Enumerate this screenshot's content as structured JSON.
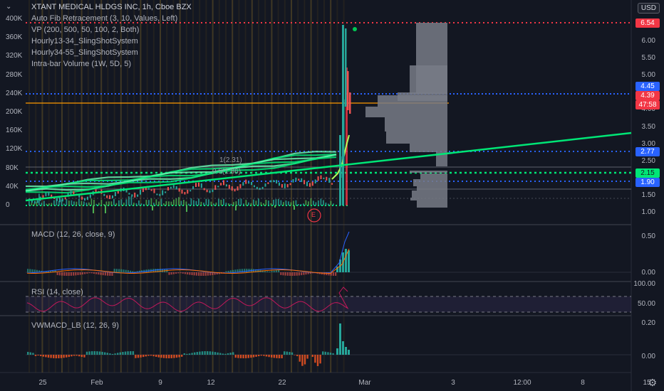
{
  "chart": {
    "title": "XTANT MEDICAL HLDGS INC, 1h, Cboe BZX",
    "indicators": [
      "Auto Fib Retracement (3, 10, Values, Left)",
      "VP (200, 500, 50, 100, 2, Both)",
      "Hourly13-34_SlingShotSystem",
      "Hourly34-55_SlingShotSystem",
      "Intra-bar Volume (1W, 5D, 5)"
    ],
    "currency": "USD",
    "fib_label_1": "1(2.31)",
    "fib_label_2": "0.5(1.86)",
    "earnings_marker": "E",
    "volume_axis": [
      "400K",
      "360K",
      "320K",
      "280K",
      "240K",
      "200K",
      "160K",
      "120K",
      "80K",
      "40K",
      "0"
    ],
    "price_axis": [
      "6.00",
      "5.50",
      "5.00",
      "4.50",
      "4.00",
      "3.50",
      "3.00",
      "2.50",
      "2.00",
      "1.50",
      "1.00"
    ],
    "price_badges": {
      "top": {
        "text": "6.54",
        "color": "#f23645"
      },
      "high": {
        "text": "4.45",
        "color": "#2962ff"
      },
      "last": {
        "text": "4.39",
        "color": "#f23645"
      },
      "countdown": {
        "text": "47:58",
        "color": "#f23645"
      },
      "mid": {
        "text": "2.77",
        "color": "#2962ff"
      },
      "green": {
        "text": "2.15",
        "color": "#00e676"
      },
      "low": {
        "text": "1.90",
        "color": "#2962ff"
      }
    },
    "x_axis": [
      "25",
      "Feb",
      "9",
      "12",
      "22",
      "Mar",
      "3",
      "12:00",
      "8",
      "15"
    ]
  },
  "macd": {
    "title": "MACD (12, 26, close, 9)",
    "axis": [
      "0.50",
      "0.00"
    ]
  },
  "rsi": {
    "title": "RSI (14, close)",
    "axis": [
      "100.00",
      "50.00"
    ]
  },
  "vwmacd": {
    "title": "VWMACD_LB (12, 26, 9)",
    "axis": [
      "0.20",
      "0.00"
    ]
  },
  "chart_data": {
    "type": "line",
    "title": "XTANT MEDICAL HLDGS INC, 1h, Cboe BZX",
    "x": [
      "25",
      "Feb",
      "9",
      "12",
      "22",
      "Mar"
    ],
    "series": [
      {
        "values": [
          1.45,
          1.55,
          1.62,
          1.72,
          1.82,
          1.95,
          2.08,
          2.2,
          2.32,
          2.45,
          2.6,
          2.75,
          2.9,
          3.05,
          3.18,
          3.3
        ]
      }
    ],
    "ylim": [
      1.0,
      6.6
    ]
  }
}
